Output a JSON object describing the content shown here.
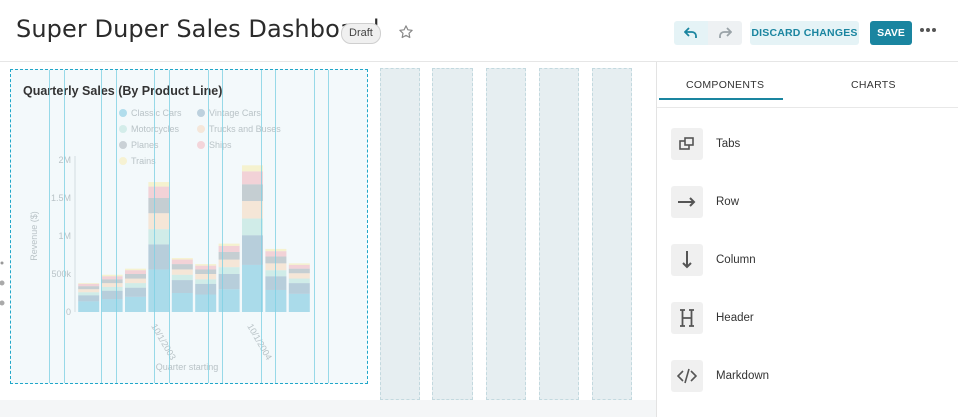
{
  "header": {
    "title": "Super Duper Sales Dashboard",
    "status_badge": "Draft",
    "discard_label": "DISCARD CHANGES",
    "save_label": "SAVE"
  },
  "sidebar": {
    "tabs": [
      {
        "label": "COMPONENTS",
        "active": true
      },
      {
        "label": "CHARTS",
        "active": false
      }
    ],
    "components": [
      {
        "label": "Tabs",
        "icon": "tabs-icon"
      },
      {
        "label": "Row",
        "icon": "row-arrow-icon"
      },
      {
        "label": "Column",
        "icon": "column-arrow-icon"
      },
      {
        "label": "Header",
        "icon": "header-h-icon"
      },
      {
        "label": "Markdown",
        "icon": "markdown-code-icon"
      }
    ]
  },
  "colors": {
    "accent": "#1a85a0",
    "accent_light": "#e5f3f6"
  },
  "chart_data": {
    "type": "bar",
    "stacked": true,
    "title": "Quarterly Sales (By Product Line)",
    "xlabel": "Quarter starting",
    "ylabel": "Revenue ($)",
    "ylim": [
      0,
      2000000
    ],
    "yticks": [
      "0",
      "500k",
      "1M",
      "1.5M",
      "2M"
    ],
    "xtick_labels": [
      "10/1/2003",
      "10/1/2004"
    ],
    "legend": {
      "placement": "top",
      "entries": [
        "Classic Cars",
        "Vintage Cars",
        "Motorcycles",
        "Trucks and Buses",
        "Planes",
        "Ships",
        "Trains"
      ]
    },
    "series": [
      {
        "name": "Classic Cars",
        "color": "#7ac6e0",
        "values": [
          140000,
          170000,
          200000,
          560000,
          250000,
          230000,
          300000,
          620000,
          290000,
          240000
        ]
      },
      {
        "name": "Vintage Cars",
        "color": "#8fb1c7",
        "values": [
          80000,
          110000,
          120000,
          330000,
          170000,
          140000,
          200000,
          390000,
          180000,
          140000
        ]
      },
      {
        "name": "Motorcycles",
        "color": "#b9e3dc",
        "values": [
          40000,
          50000,
          60000,
          200000,
          70000,
          60000,
          90000,
          220000,
          80000,
          60000
        ]
      },
      {
        "name": "Trucks and Buses",
        "color": "#f6d9c0",
        "values": [
          40000,
          50000,
          60000,
          210000,
          70000,
          70000,
          100000,
          230000,
          90000,
          70000
        ]
      },
      {
        "name": "Planes",
        "color": "#a7b0b8",
        "values": [
          40000,
          50000,
          60000,
          200000,
          70000,
          60000,
          100000,
          220000,
          90000,
          60000
        ]
      },
      {
        "name": "Ships",
        "color": "#f2b8c0",
        "values": [
          30000,
          40000,
          50000,
          150000,
          60000,
          50000,
          80000,
          170000,
          70000,
          50000
        ]
      },
      {
        "name": "Trains",
        "color": "#f7edb3",
        "values": [
          10000,
          20000,
          20000,
          60000,
          20000,
          20000,
          30000,
          80000,
          30000,
          20000
        ]
      }
    ]
  }
}
